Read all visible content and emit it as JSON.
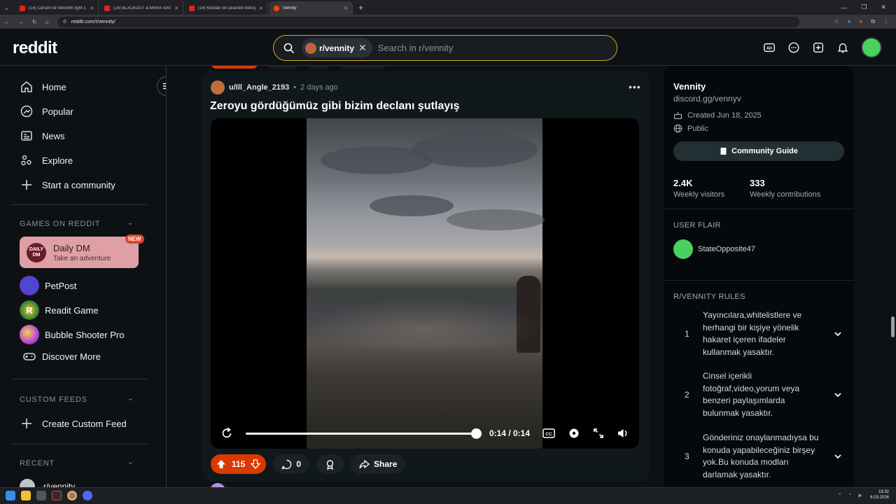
{
  "browser": {
    "tabs": [
      {
        "label": "(14) Carson ve Nitronith fight s"
      },
      {
        "label": "(14) BLXCKOUT & MARA SANTI"
      },
      {
        "label": "(14) Klodian ve Deandre konuş"
      },
      {
        "label": "Vennity"
      }
    ],
    "url": "reddit.com/r/vennity/"
  },
  "header": {
    "logo": "reddit",
    "search_chip": "r/vennity",
    "search_placeholder": "Search in r/vennity"
  },
  "sidebar": {
    "nav": [
      {
        "label": "Home",
        "icon": "home-icon"
      },
      {
        "label": "Popular",
        "icon": "popular-icon"
      },
      {
        "label": "News",
        "icon": "news-icon"
      },
      {
        "label": "Explore",
        "icon": "explore-icon"
      },
      {
        "label": "Start a community",
        "icon": "plus-icon"
      }
    ],
    "games_header": "GAMES ON REDDIT",
    "daily_dm": {
      "logo": "DAILY DM",
      "title": "Daily DM",
      "subtitle": "Take an adventure",
      "badge": "NEW"
    },
    "games": [
      {
        "label": "PetPost"
      },
      {
        "label": "Readit Game"
      },
      {
        "label": "Bubble Shooter Pro"
      },
      {
        "label": "Discover More"
      }
    ],
    "custom_feeds_header": "CUSTOM FEEDS",
    "create_custom_feed": "Create Custom Feed",
    "recent_header": "RECENT",
    "recent_item": "r/vennity"
  },
  "post": {
    "author": "u/Ill_Angle_2193",
    "time": "2 days ago",
    "title": "Zeroyu gördüğümüz gibi bizim declanı şutlayış",
    "video_time": "0:14 / 0:14",
    "video_progress": 1.0,
    "votes": "115",
    "comments": "0",
    "share": "Share"
  },
  "community": {
    "name": "Vennity",
    "description": "discord.gg/vennyv",
    "created": "Created Jun 18, 2025",
    "visibility": "Public",
    "guide_button": "Community Guide",
    "stats": [
      {
        "value": "2.4K",
        "label": "Weekly visitors"
      },
      {
        "value": "333",
        "label": "Weekly contributions"
      }
    ],
    "user_flair_header": "USER FLAIR",
    "flair_user": "StateOpposite47",
    "rules_header": "R/VENNITY RULES",
    "rules": [
      {
        "num": "1",
        "text": "Yayıncılara,whitelistlere ve herhangi bir kişiye yönelik hakaret içeren ifadeler kullanmak yasaktır."
      },
      {
        "num": "2",
        "text": "Cinsel içerikli fotoğraf,video,yorum veya benzeri paylaşımlarda bulunmak yasaktır."
      },
      {
        "num": "3",
        "text": "Gönderiniz onaylanmadıysa bu konuda yapabileceğiniz birşey yok.Bu konuda modları darlamak yasaktır."
      }
    ]
  },
  "taskbar": {
    "time": "18:32",
    "date": "6.03.2026"
  }
}
